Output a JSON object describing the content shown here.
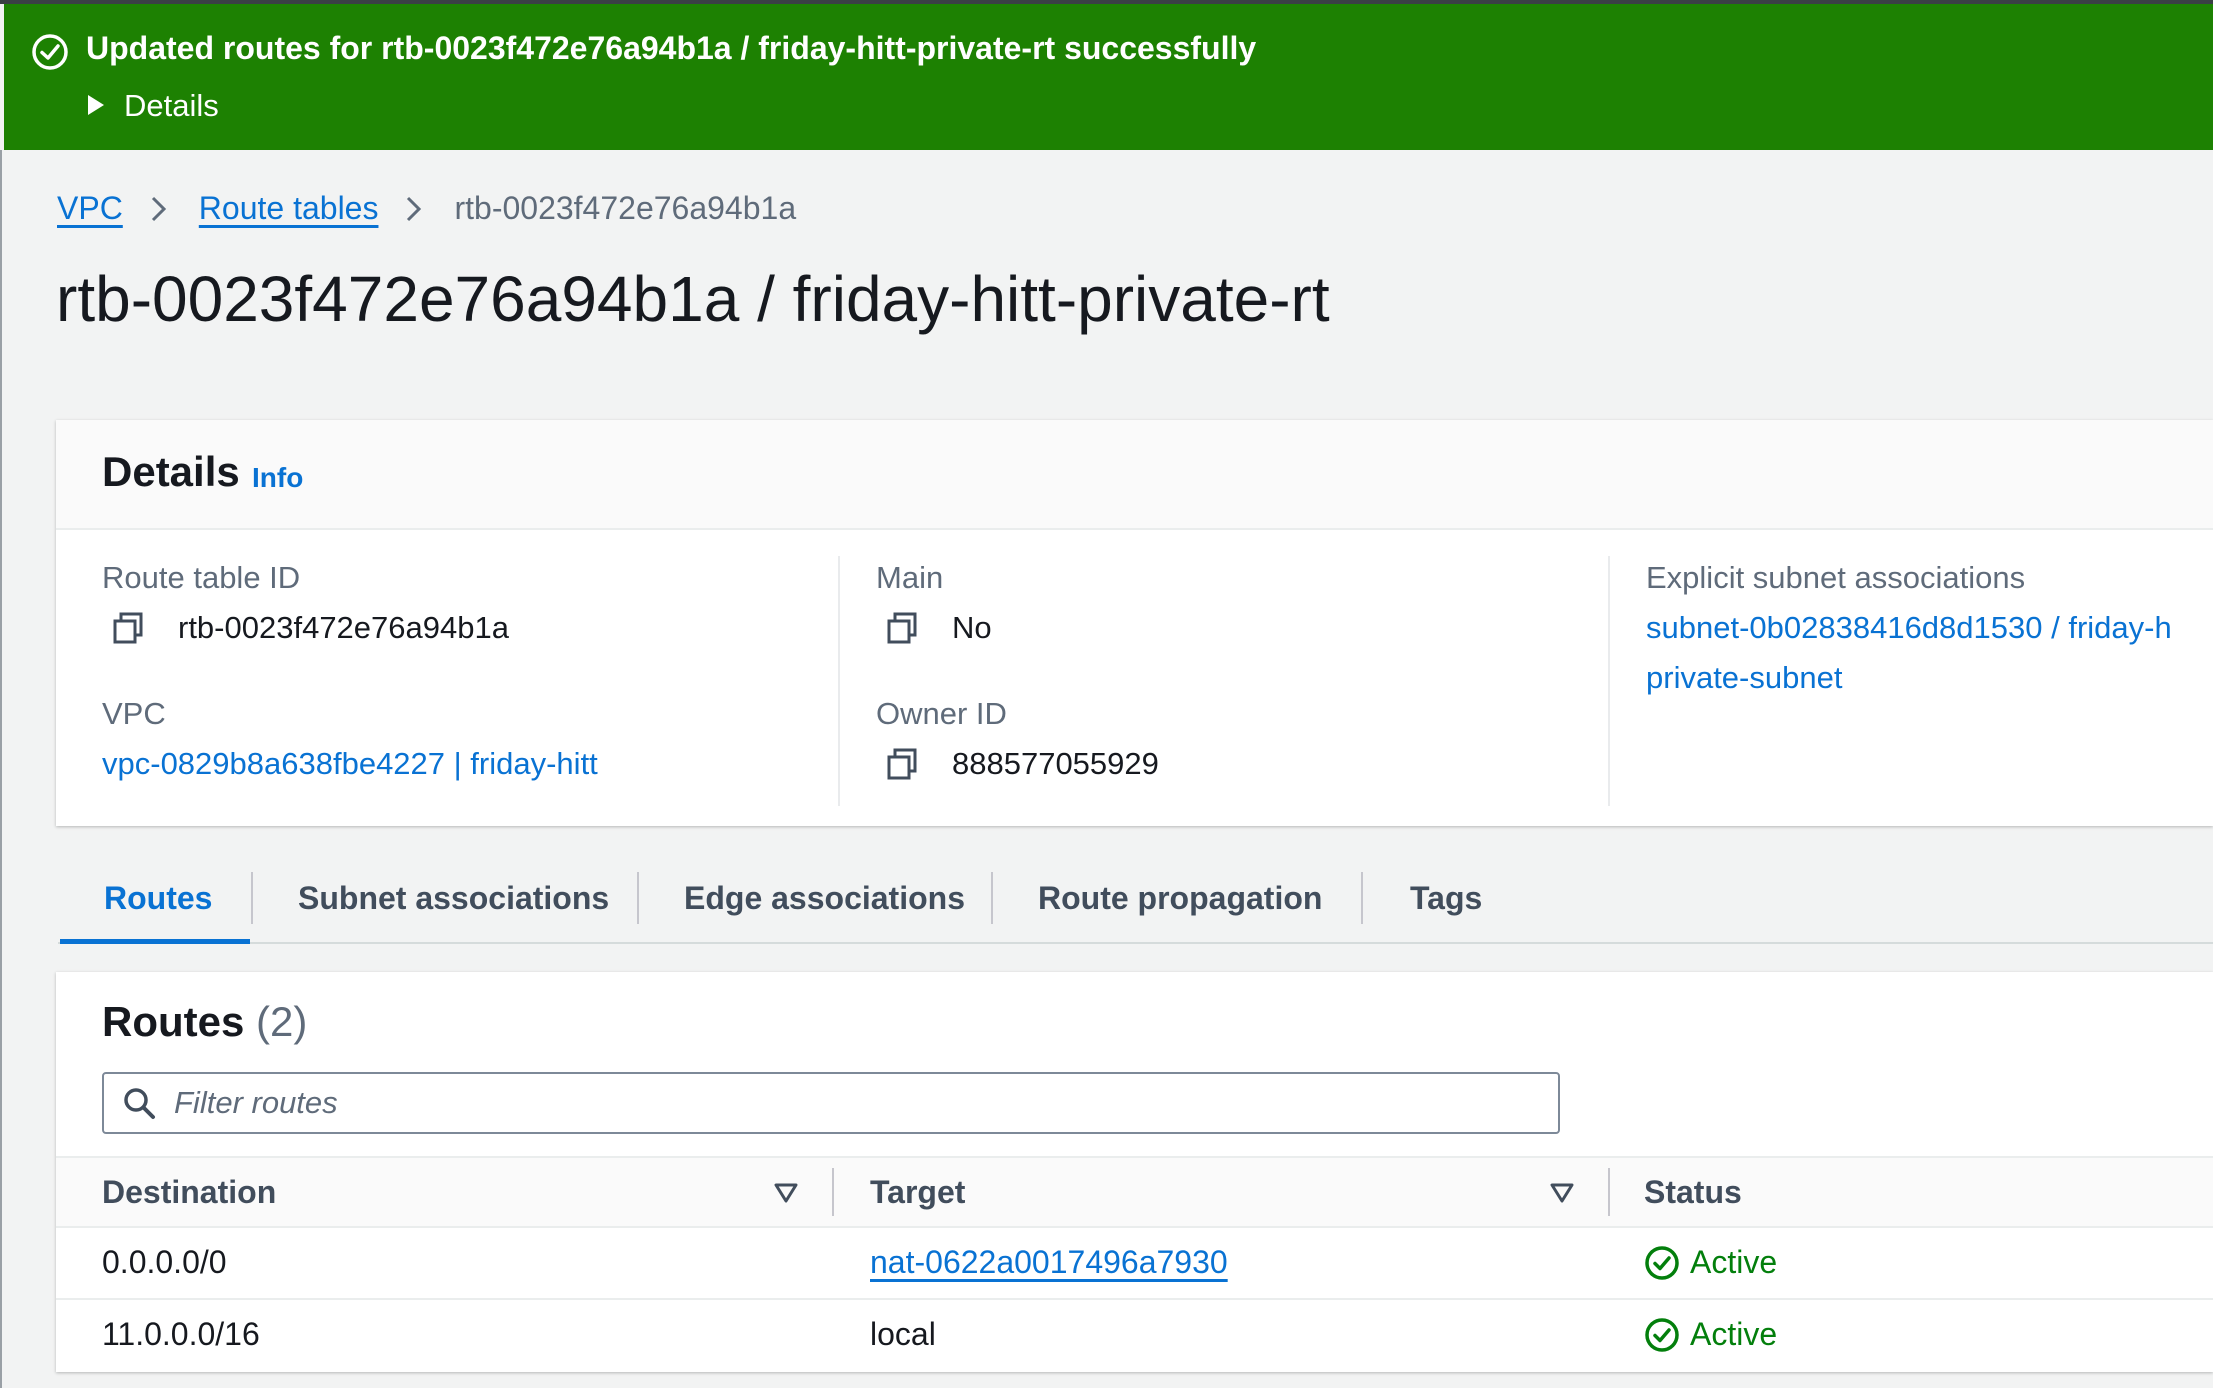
{
  "flash": {
    "message": "Updated routes for rtb-0023f472e76a94b1a / friday-hitt-private-rt successfully",
    "details_label": "Details",
    "color": "#1d8102"
  },
  "breadcrumb": {
    "items": [
      "VPC",
      "Route tables"
    ],
    "current": "rtb-0023f472e76a94b1a"
  },
  "page_title": "rtb-0023f472e76a94b1a / friday-hitt-private-rt",
  "details": {
    "title": "Details",
    "info_label": "Info",
    "route_table_id_label": "Route table ID",
    "route_table_id": "rtb-0023f472e76a94b1a",
    "main_label": "Main",
    "main": "No",
    "explicit_label": "Explicit subnet associations",
    "explicit_line1": "subnet-0b02838416d8d1530 / friday-h",
    "explicit_line2": "private-subnet",
    "vpc_label": "VPC",
    "vpc": "vpc-0829b8a638fbe4227 | friday-hitt",
    "owner_label": "Owner ID",
    "owner": "888577055929"
  },
  "tabs": [
    {
      "label": "Routes",
      "active": true
    },
    {
      "label": "Subnet associations",
      "active": false
    },
    {
      "label": "Edge associations",
      "active": false
    },
    {
      "label": "Route propagation",
      "active": false
    },
    {
      "label": "Tags",
      "active": false
    }
  ],
  "routes": {
    "title": "Routes",
    "count": "(2)",
    "filter_placeholder": "Filter routes",
    "columns": [
      "Destination",
      "Target",
      "Status"
    ],
    "rows": [
      {
        "destination": "0.0.0.0/0",
        "target": "nat-0622a0017496a7930",
        "target_is_link": true,
        "status": "Active"
      },
      {
        "destination": "11.0.0.0/16",
        "target": "local",
        "target_is_link": false,
        "status": "Active"
      }
    ]
  },
  "colors": {
    "link": "#0972d3",
    "success": "#037f0c",
    "text": "#16191f",
    "muted": "#5f6b7a"
  },
  "icons": [
    "check-circle-icon",
    "caret-right-icon",
    "chevron-right-icon",
    "copy-icon",
    "search-icon",
    "sort-down-icon"
  ]
}
